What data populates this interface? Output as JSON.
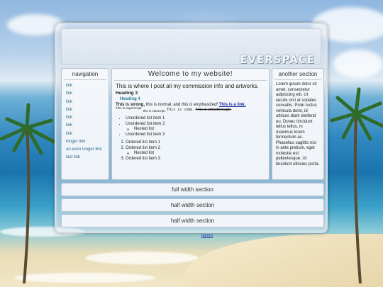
{
  "header": {
    "logo_text": "EVERSPACE"
  },
  "nav": {
    "title": "navigation",
    "items": [
      {
        "label": "link"
      },
      {
        "label": "link"
      },
      {
        "label": "link"
      },
      {
        "label": "link"
      },
      {
        "label": "link"
      },
      {
        "label": "link"
      },
      {
        "label": "link"
      },
      {
        "label": "longer link"
      },
      {
        "label": "an even longer link"
      },
      {
        "label": "last link"
      }
    ]
  },
  "main": {
    "title": "Welcome to my website!",
    "intro": "This is where I post all my commission info and artworks.",
    "heading3": "Heading 3",
    "heading4": "Heading 4",
    "strong": "This is strong,",
    "normal": " this is normal, and ",
    "emph": "this is emphasized!",
    "link": "This is a link.",
    "superscript": "This is superscript.",
    "subscript": "this is subscript.",
    "code": "This is code.",
    "strike": "This is strikethrough.",
    "ul": [
      "Unordered list item 1",
      "Unordered list item 2",
      "Nested list",
      "Unordered list item 3"
    ],
    "ol": [
      "Ordered list item 1",
      "Ordered list item 2",
      "Nested list",
      "Ordered list item 3"
    ]
  },
  "aside": {
    "title": "another section",
    "text": "Lorem ipsum dolor sit amet, consectetur adipiscing elit. Ut iaculis orci at sodales convallis. Proin luctus vehicula dolor, id ultrices diam eleifend eu. Donec tincidunt tellus tellus, in maximus lorem fermentum ac. Phasellus sagittis nisi in ante pretium, eget molestie est pellentesque. Ut tincidunt ultricies porta."
  },
  "sections": {
    "full": "full width section",
    "half1": "half width section",
    "half2": "half width section"
  },
  "footer": {
    "link": "layout"
  },
  "colors": {
    "link": "#2a6a8a",
    "accent": "#2a7a9a"
  }
}
